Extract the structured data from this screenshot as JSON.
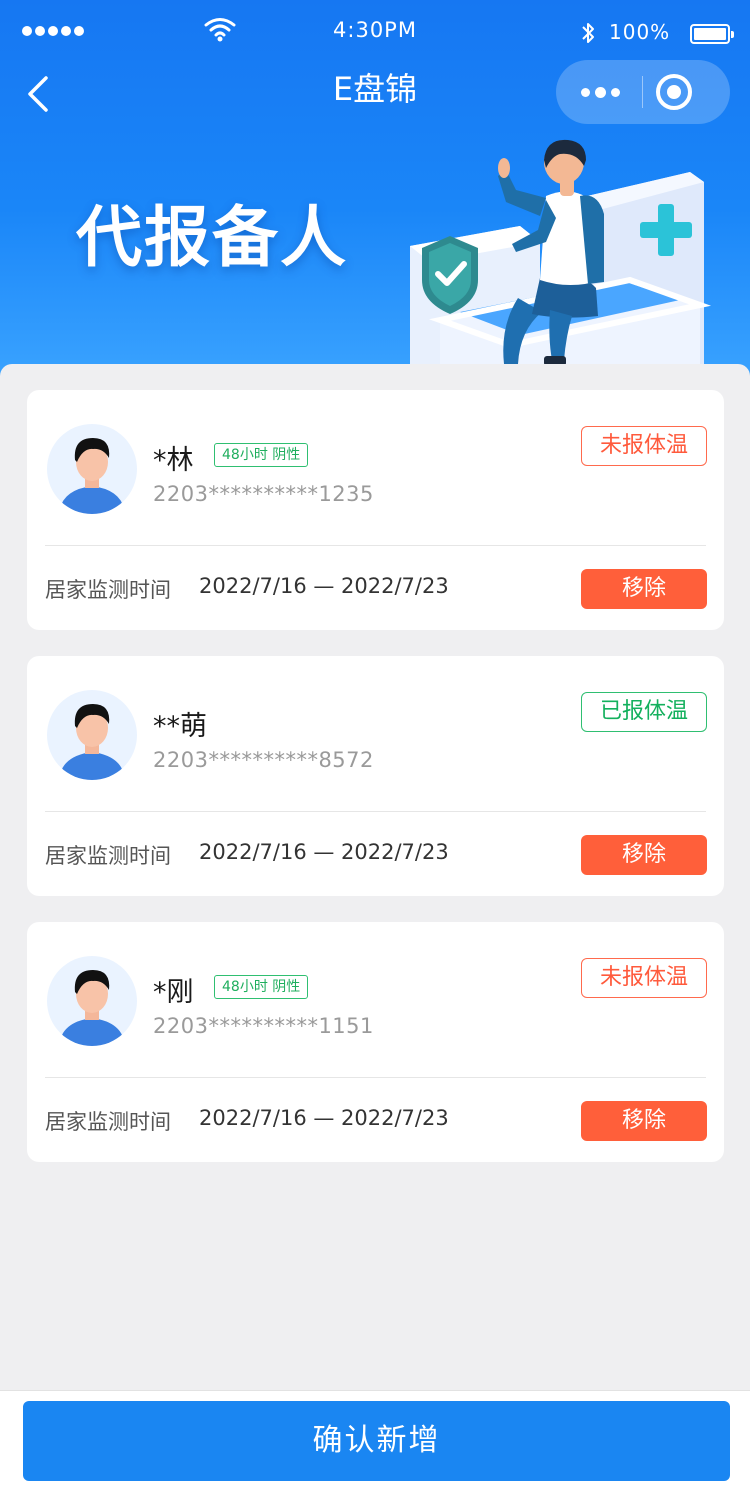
{
  "status_bar": {
    "time": "4:30PM",
    "battery": "100%"
  },
  "nav": {
    "title": "E盘锦"
  },
  "banner": {
    "title": "代报备人"
  },
  "people": [
    {
      "name": "*林",
      "tag": "48小时 阴性",
      "id_number": "2203**********1235",
      "status": "未报体温",
      "status_type": "red",
      "monitor_label": "居家监测时间",
      "monitor_range": "2022/7/16 — 2022/7/23",
      "remove_label": "移除"
    },
    {
      "name": "**萌",
      "tag": "",
      "id_number": "2203**********8572",
      "status": "已报体温",
      "status_type": "green",
      "monitor_label": "居家监测时间",
      "monitor_range": "2022/7/16 — 2022/7/23",
      "remove_label": "移除"
    },
    {
      "name": "*刚",
      "tag": "48小时 阴性",
      "id_number": "2203**********1151",
      "status": "未报体温",
      "status_type": "red",
      "monitor_label": "居家监测时间",
      "monitor_range": "2022/7/16 — 2022/7/23",
      "remove_label": "移除"
    }
  ],
  "footer": {
    "confirm_label": "确认新增"
  },
  "colors": {
    "primary": "#1a86f2",
    "danger": "#ff5f3a",
    "success": "#2fbf71"
  }
}
